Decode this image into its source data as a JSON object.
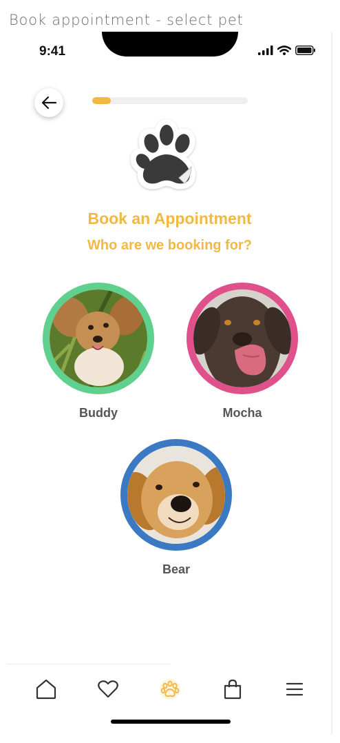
{
  "frame": {
    "title": "Book appointment - select pet"
  },
  "status_bar": {
    "time": "9:41",
    "icons": [
      "signal-icon",
      "wifi-icon",
      "battery-icon"
    ]
  },
  "header": {
    "back_icon": "arrow-left-icon",
    "progress": 0.12
  },
  "main": {
    "title": "Book an Appointment",
    "subtitle": "Who are we booking for?"
  },
  "pets": [
    {
      "name": "Buddy",
      "ring_color": "#5fd08e"
    },
    {
      "name": "Mocha",
      "ring_color": "#e0508a"
    },
    {
      "name": "Bear",
      "ring_color": "#3b7ac2"
    }
  ],
  "tabbar": {
    "items": [
      "home-icon",
      "heart-icon",
      "paw-icon",
      "shopping-bag-icon",
      "menu-icon"
    ],
    "active": "paw-icon"
  },
  "colors": {
    "accent": "#f1b844",
    "progress": "#f4b840",
    "text_muted": "#555555"
  }
}
